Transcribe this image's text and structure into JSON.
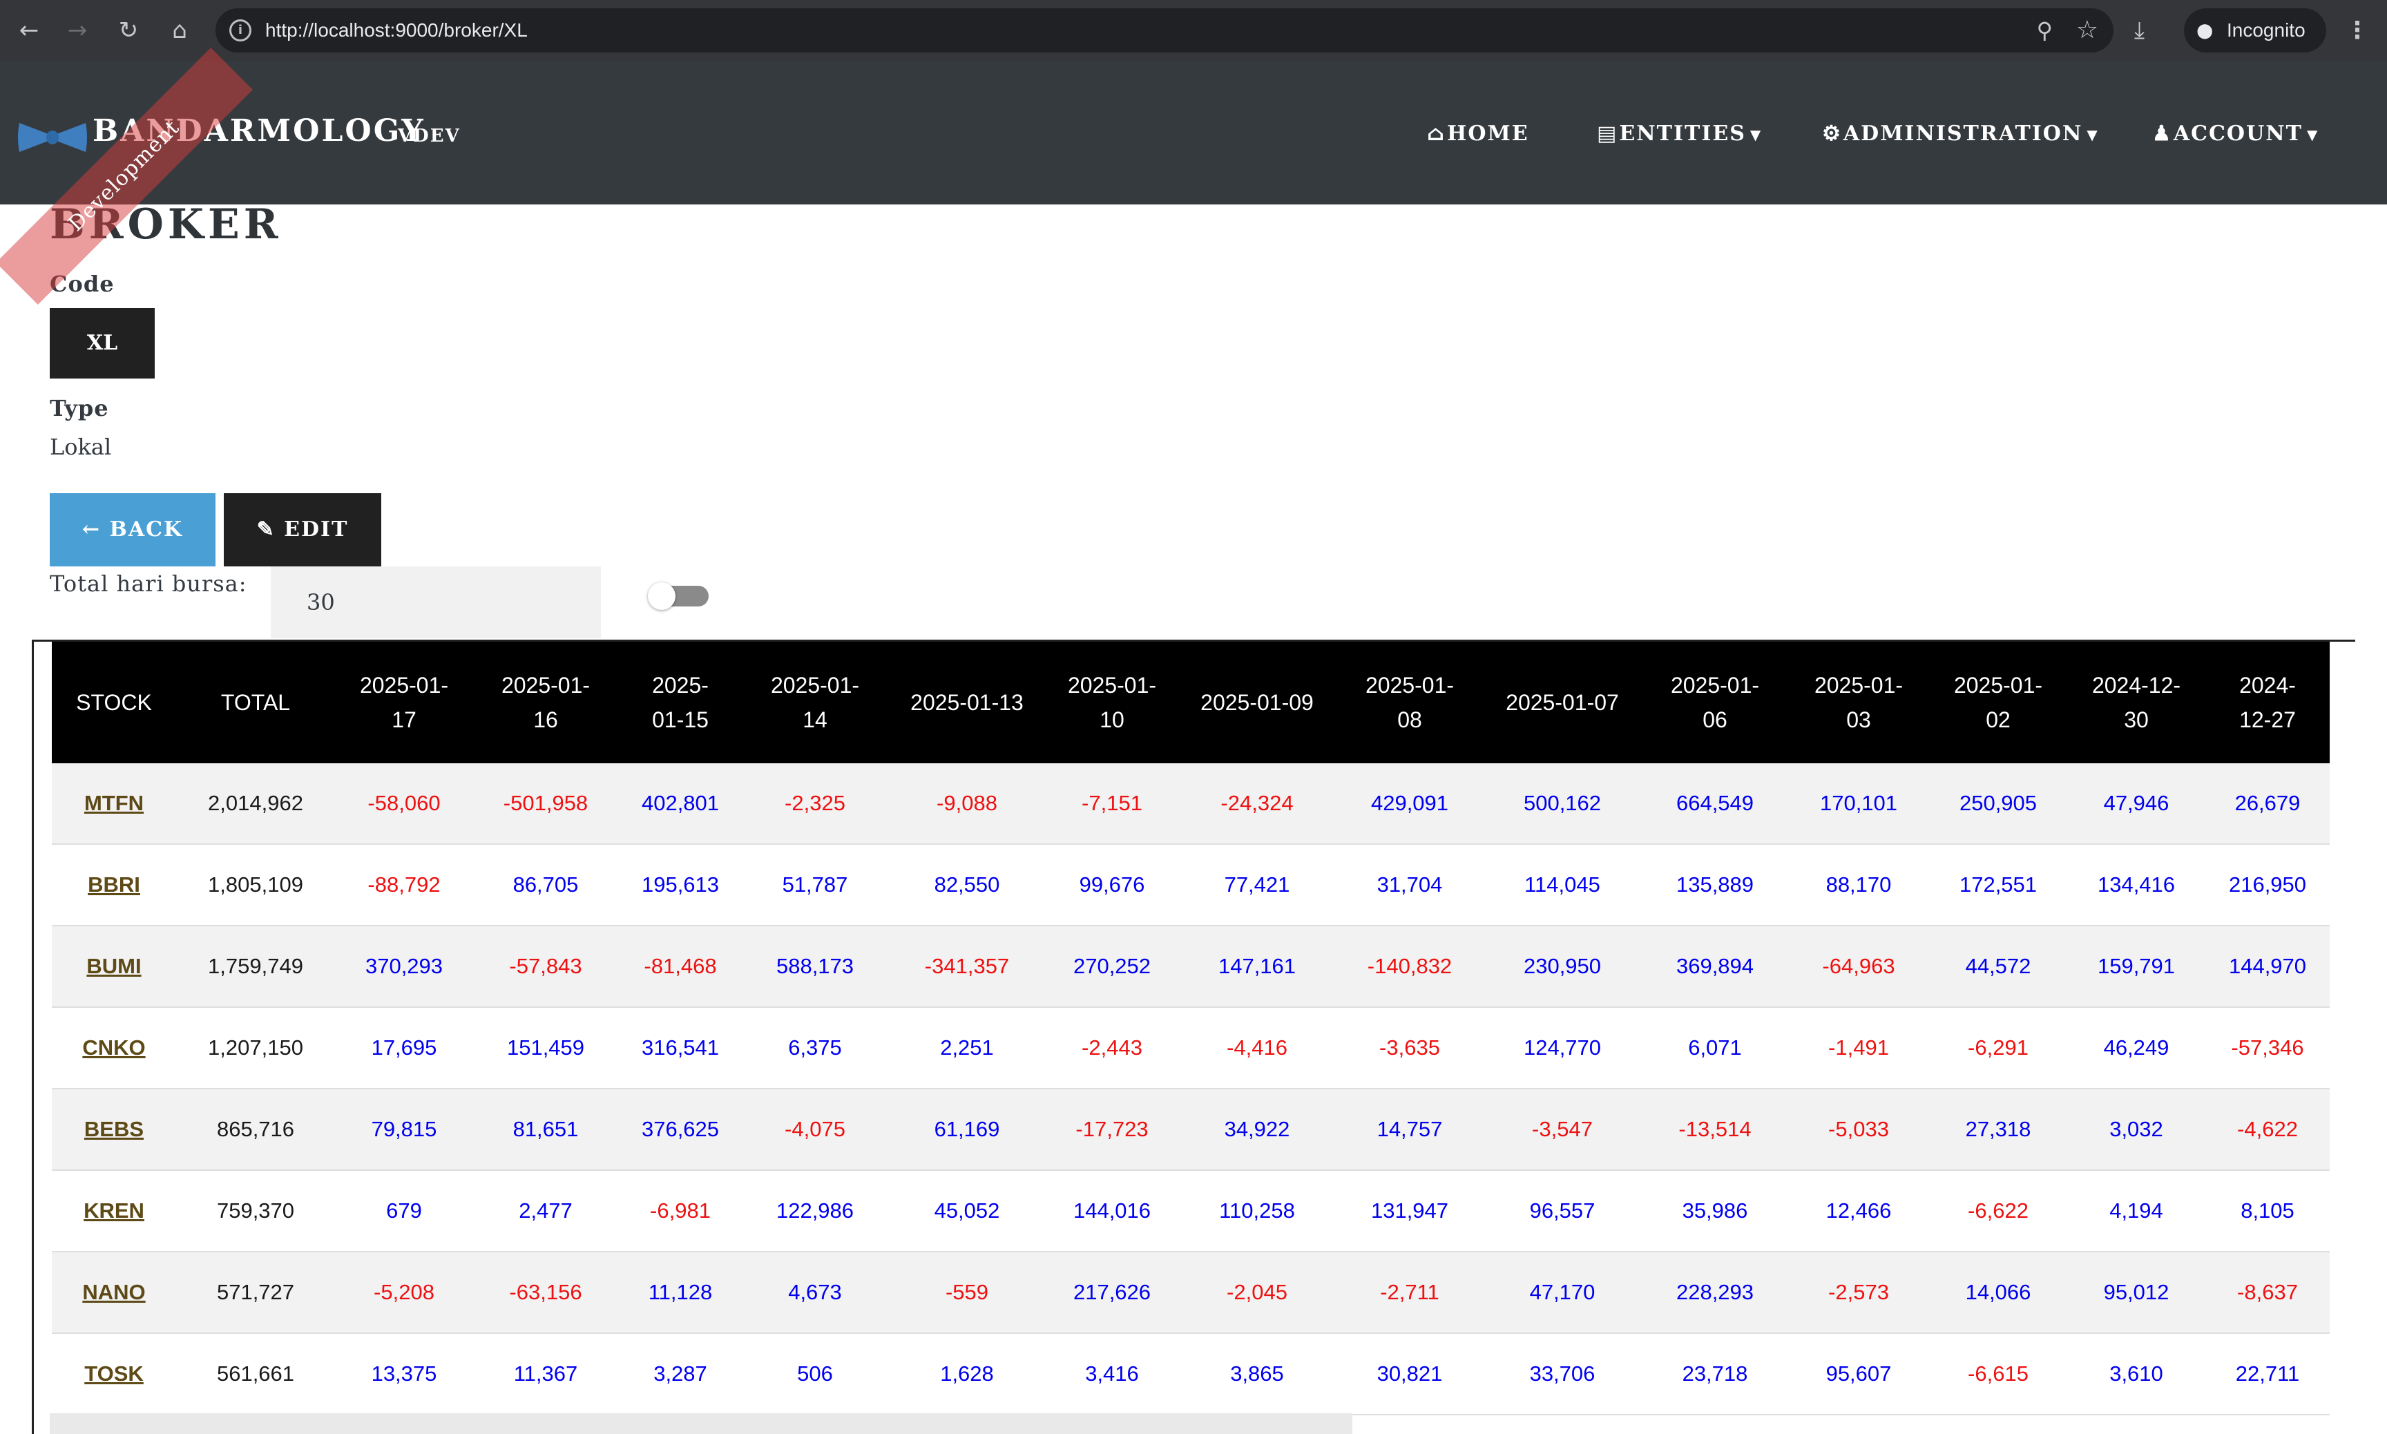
{
  "browser": {
    "url": "http://localhost:9000/broker/XL",
    "incognito_label": "Incognito"
  },
  "header": {
    "brand": "BANDARMOLOGY",
    "version": "VDEV",
    "ribbon": "Development",
    "menu": {
      "home": "HOME",
      "entities": "ENTITIES",
      "administration": "ADMINISTRATION",
      "account": "ACCOUNT"
    }
  },
  "broker": {
    "title": "BROKER",
    "code_label": "Code",
    "code_value": "XL",
    "type_label": "Type",
    "type_value": "Lokal",
    "back_label": "BACK",
    "edit_label": "EDIT"
  },
  "controls": {
    "total_hari_label": "Total hari bursa:",
    "total_hari_value": "30",
    "toggle_on": false
  },
  "colors": {
    "positive": "#0000ee",
    "negative": "#ee1111",
    "header_bg": "#353a3f",
    "back_button": "#4aa0d5"
  },
  "table": {
    "columns": [
      "STOCK",
      "TOTAL",
      "2025-01-17",
      "2025-01-16",
      "2025-01-15",
      "2025-01-14",
      "2025-01-13",
      "2025-01-10",
      "2025-01-09",
      "2025-01-08",
      "2025-01-07",
      "2025-01-06",
      "2025-01-03",
      "2025-01-02",
      "2024-12-30",
      "2024-12-27"
    ],
    "rows": [
      {
        "stock": "MTFN",
        "total": "2,014,962",
        "values": [
          "-58,060",
          "-501,958",
          "402,801",
          "-2,325",
          "-9,088",
          "-7,151",
          "-24,324",
          "429,091",
          "500,162",
          "664,549",
          "170,101",
          "250,905",
          "47,946",
          "26,679"
        ]
      },
      {
        "stock": "BBRI",
        "total": "1,805,109",
        "values": [
          "-88,792",
          "86,705",
          "195,613",
          "51,787",
          "82,550",
          "99,676",
          "77,421",
          "31,704",
          "114,045",
          "135,889",
          "88,170",
          "172,551",
          "134,416",
          "216,950"
        ]
      },
      {
        "stock": "BUMI",
        "total": "1,759,749",
        "values": [
          "370,293",
          "-57,843",
          "-81,468",
          "588,173",
          "-341,357",
          "270,252",
          "147,161",
          "-140,832",
          "230,950",
          "369,894",
          "-64,963",
          "44,572",
          "159,791",
          "144,970"
        ]
      },
      {
        "stock": "CNKO",
        "total": "1,207,150",
        "values": [
          "17,695",
          "151,459",
          "316,541",
          "6,375",
          "2,251",
          "-2,443",
          "-4,416",
          "-3,635",
          "124,770",
          "6,071",
          "-1,491",
          "-6,291",
          "46,249",
          "-57,346"
        ]
      },
      {
        "stock": "BEBS",
        "total": "865,716",
        "values": [
          "79,815",
          "81,651",
          "376,625",
          "-4,075",
          "61,169",
          "-17,723",
          "34,922",
          "14,757",
          "-3,547",
          "-13,514",
          "-5,033",
          "27,318",
          "3,032",
          "-4,622"
        ]
      },
      {
        "stock": "KREN",
        "total": "759,370",
        "values": [
          "679",
          "2,477",
          "-6,981",
          "122,986",
          "45,052",
          "144,016",
          "110,258",
          "131,947",
          "96,557",
          "35,986",
          "12,466",
          "-6,622",
          "4,194",
          "8,105"
        ]
      },
      {
        "stock": "NANO",
        "total": "571,727",
        "values": [
          "-5,208",
          "-63,156",
          "11,128",
          "4,673",
          "-559",
          "217,626",
          "-2,045",
          "-2,711",
          "47,170",
          "228,293",
          "-2,573",
          "14,066",
          "95,012",
          "-8,637"
        ]
      },
      {
        "stock": "TOSK",
        "total": "561,661",
        "values": [
          "13,375",
          "11,367",
          "3,287",
          "506",
          "1,628",
          "3,416",
          "3,865",
          "30,821",
          "33,706",
          "23,718",
          "95,607",
          "-6,615",
          "3,610",
          "22,711"
        ]
      }
    ]
  }
}
